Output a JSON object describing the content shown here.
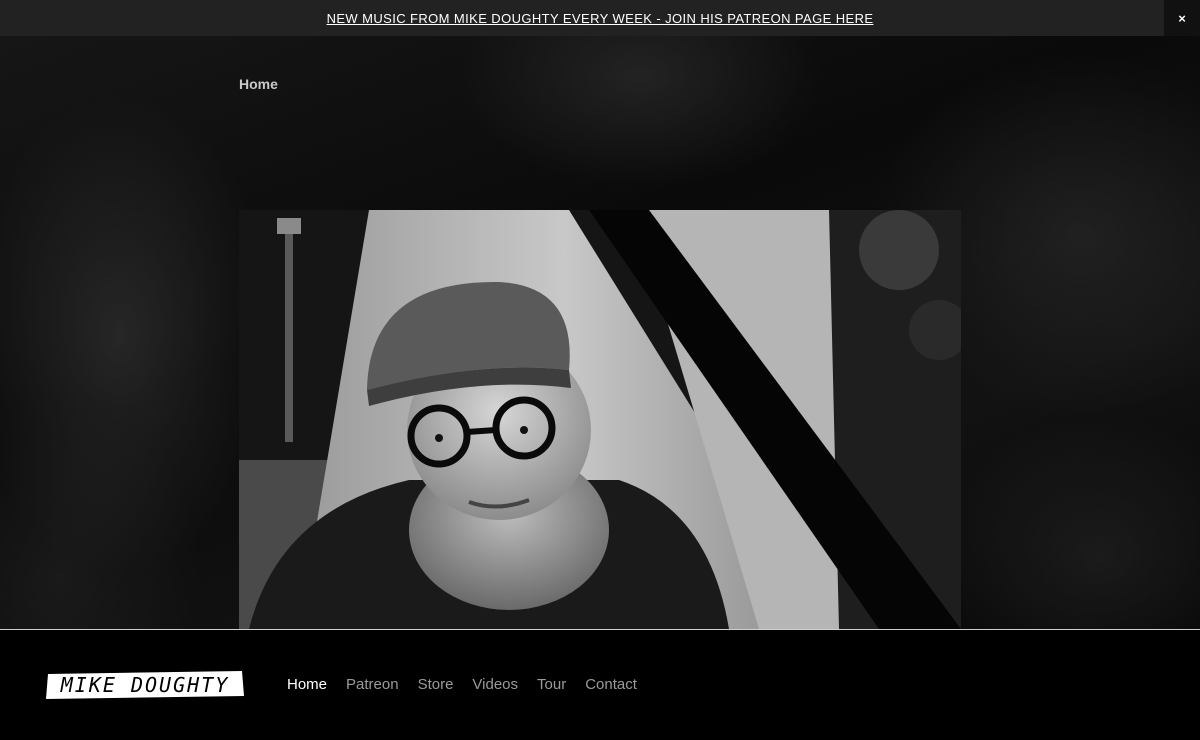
{
  "announcement": {
    "text": "NEW MUSIC FROM MIKE DOUGHTY EVERY WEEK - JOIN HIS PATREON PAGE HERE",
    "close_label": "×"
  },
  "breadcrumb": {
    "label": "Home"
  },
  "hero_image": {
    "alt": "Mike Doughty"
  },
  "logo": {
    "text": "MIKE DOUGHTY"
  },
  "nav": {
    "items": [
      {
        "label": "Home",
        "active": true
      },
      {
        "label": "Patreon"
      },
      {
        "label": "Store"
      },
      {
        "label": "Videos"
      },
      {
        "label": "Tour"
      },
      {
        "label": "Contact"
      }
    ]
  }
}
